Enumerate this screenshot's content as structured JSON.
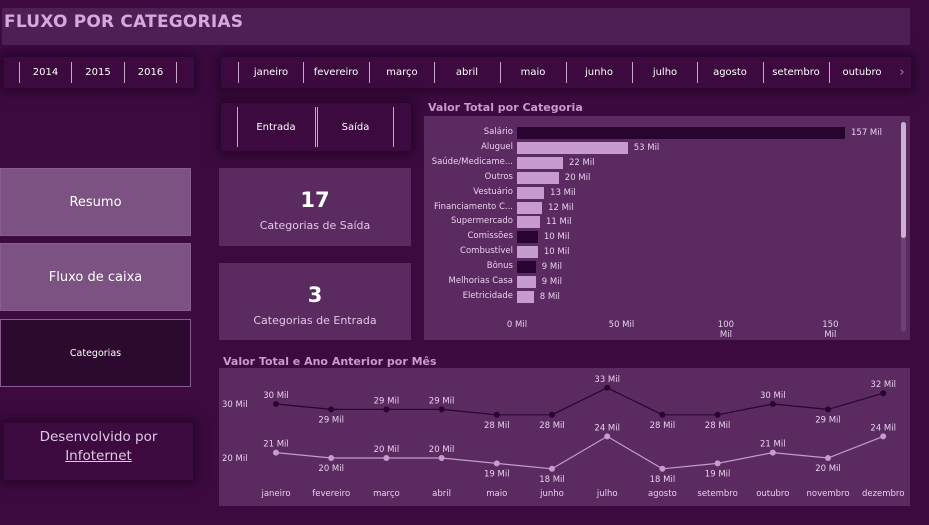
{
  "header": {
    "title": "FLUXO POR CATEGORIAS"
  },
  "years": [
    "2014",
    "2015",
    "2016"
  ],
  "months_slicer": [
    "janeiro",
    "fevereiro",
    "março",
    "abril",
    "maio",
    "junho",
    "julho",
    "agosto",
    "setembro",
    "outubro"
  ],
  "type_slicer": [
    "Entrada",
    "Saída"
  ],
  "kpis": {
    "saida": {
      "value": "17",
      "label": "Categorias de Saída"
    },
    "entrada": {
      "value": "3",
      "label": "Categorias de Entrada"
    }
  },
  "nav": {
    "resumo": "Resumo",
    "fluxo": "Fluxo de caixa",
    "categorias": "Categorias"
  },
  "footer": {
    "line1": "Desenvolvido por",
    "link": "Infoternet"
  },
  "colors": {
    "bar_light": "#c79ad0",
    "bar_dark": "#2a0430",
    "line_light": "#c79ad0",
    "line_dark": "#2a0430",
    "panel": "#5a2a60"
  },
  "chart_data": [
    {
      "type": "bar",
      "title": "Valor Total por Categoria",
      "categories": [
        "Salário",
        "Aluguel",
        "Saúde/Medicame...",
        "Outros",
        "Vestuário",
        "Financiamento C...",
        "Supermercado",
        "Comissões",
        "Combustível",
        "Bônus",
        "Melhorias Casa",
        "Eletricidade"
      ],
      "values": [
        157,
        53,
        22,
        20,
        13,
        12,
        11,
        10,
        10,
        9,
        9,
        8
      ],
      "value_labels": [
        "157 Mil",
        "53 Mil",
        "22 Mil",
        "20 Mil",
        "13 Mil",
        "12 Mil",
        "11 Mil",
        "10 Mil",
        "10 Mil",
        "9 Mil",
        "9 Mil",
        "8 Mil"
      ],
      "dark": [
        true,
        false,
        false,
        false,
        false,
        false,
        false,
        true,
        false,
        true,
        false,
        false
      ],
      "x_ticks": [
        "0 Mil",
        "50 Mil",
        "100 Mil",
        "150 Mil"
      ],
      "xlim": [
        0,
        160
      ]
    },
    {
      "type": "line",
      "title": "Valor Total e Ano Anterior por Mês",
      "categories": [
        "janeiro",
        "fevereiro",
        "março",
        "abril",
        "maio",
        "junho",
        "julho",
        "agosto",
        "setembro",
        "outubro",
        "novembro",
        "dezembro"
      ],
      "y_ticks": [
        "30 Mil",
        "20 Mil"
      ],
      "series": [
        {
          "values": [
            30,
            29,
            29,
            29,
            28,
            28,
            33,
            28,
            28,
            30,
            29,
            32
          ],
          "labels": [
            "30 Mil",
            "29 Mil",
            "29 Mil",
            "29 Mil",
            "28 Mil",
            "28 Mil",
            "33 Mil",
            "28 Mil",
            "28 Mil",
            "30 Mil",
            "29 Mil",
            "32 Mil"
          ],
          "color": "#2a0430"
        },
        {
          "values": [
            21,
            20,
            20,
            20,
            19,
            18,
            24,
            18,
            19,
            21,
            20,
            24
          ],
          "labels": [
            "21 Mil",
            "20 Mil",
            "20 Mil",
            "20 Mil",
            "19 Mil",
            "18 Mil",
            "24 Mil",
            "18 Mil",
            "19 Mil",
            "21 Mil",
            "20 Mil",
            "24 Mil"
          ],
          "color": "#c79ad0"
        }
      ]
    }
  ]
}
